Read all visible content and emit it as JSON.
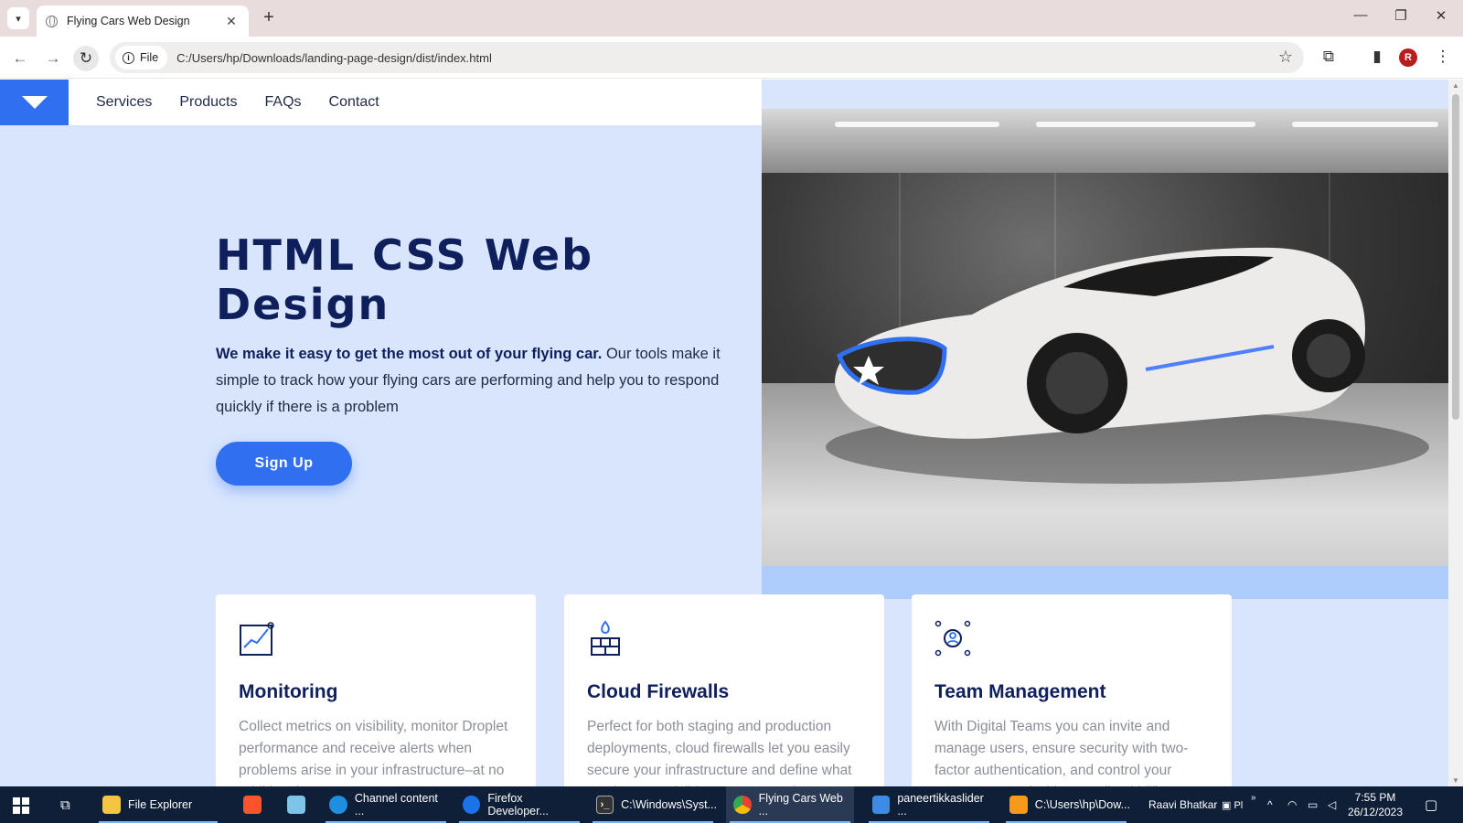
{
  "browser": {
    "tab_title": "Flying Cars Web Design",
    "new_tab_symbol": "+",
    "site_chip_label": "File",
    "url": "C:/Users/hp/Downloads/landing-page-design/dist/index.html",
    "profile_initial": "R",
    "window_minimize": "—",
    "window_restore": "❐",
    "window_close": "✕"
  },
  "nav": {
    "links": [
      "Services",
      "Products",
      "FAQs",
      "Contact"
    ]
  },
  "hero": {
    "title_line1": "HTML CSS Web",
    "title_line2": "Design",
    "lead_bold": "We make it easy to get the most out of your flying car.",
    "lead_rest": " Our tools make it simple to track how your flying cars are performing and help you to respond quickly if there is a problem",
    "cta_label": "Sign Up",
    "image_alt": "white concept car"
  },
  "features": [
    {
      "icon": "chart-line-icon",
      "title": "Monitoring",
      "text": "Collect metrics on visibility, monitor Droplet performance and receive alerts when problems arise in your infrastructure–at no additional cost."
    },
    {
      "icon": "firewall-icon",
      "title": "Cloud Firewalls",
      "text": "Perfect for both staging and production deployments, cloud firewalls let you easily secure your infrastructure and define what services are visible on your Droplets–at no additional cost."
    },
    {
      "icon": "team-icon",
      "title": "Team Management",
      "text": "With Digital Teams you can invite and manage users, ensure security with two-factor authentication, and control your resource spend with centralized billing–at no additional cost."
    }
  ],
  "taskbar": {
    "items": [
      {
        "label": "File Explorer",
        "icon": "folder-icon",
        "color": "#f5c542"
      },
      {
        "label": "",
        "icon": "brave-icon",
        "color": "#fb542b"
      },
      {
        "label": "",
        "icon": "notepad-icon",
        "color": "#7dc4e8"
      },
      {
        "label": "Channel content ...",
        "icon": "edge-icon",
        "color": "#1e8fe0"
      },
      {
        "label": "Firefox Developer...",
        "icon": "firefox-dev-icon",
        "color": "#1a73e8"
      },
      {
        "label": "C:\\Windows\\Syst...",
        "icon": "terminal-icon",
        "color": "#333333"
      },
      {
        "label": "Flying Cars Web ...",
        "icon": "chrome-icon",
        "color": "#e94235"
      },
      {
        "label": "paneertikkaslider ...",
        "icon": "vscode-icon",
        "color": "#3c8ce7"
      },
      {
        "label": "C:\\Users\\hp\\Dow...",
        "icon": "sublime-icon",
        "color": "#f79a1b"
      }
    ],
    "user_name": "Raavi Bhatkar",
    "time": "7:55 PM",
    "date": "26/12/2023"
  },
  "colors": {
    "accent": "#2f6ff0",
    "hero_bg": "#d8e5fd",
    "heading": "#0f1f5c"
  }
}
